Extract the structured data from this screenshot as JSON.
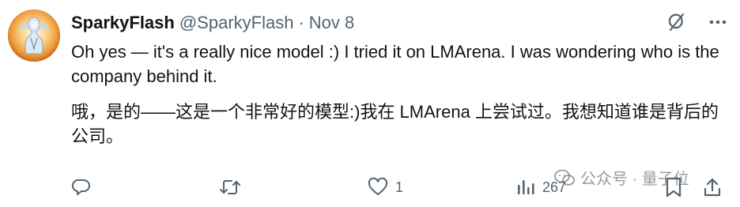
{
  "tweet": {
    "display_name": "SparkyFlash",
    "handle": "@SparkyFlash",
    "separator": "·",
    "date": "Nov 8",
    "text_en": "Oh yes — it's a really nice model :) I tried it on LMArena. I was wondering who is the company behind it.",
    "text_zh": "哦，是的——这是一个非常好的模型:)我在 LMArena 上尝试过。我想知道谁是背后的公司。"
  },
  "header_icons": [
    "grok-icon",
    "more-icon"
  ],
  "actions": {
    "reply": {
      "icon": "reply-icon",
      "count": ""
    },
    "retweet": {
      "icon": "retweet-icon",
      "count": ""
    },
    "like": {
      "icon": "heart-icon",
      "count": "1"
    },
    "views": {
      "icon": "views-icon",
      "count": "267"
    },
    "bookmark": {
      "icon": "bookmark-icon"
    },
    "share": {
      "icon": "share-icon"
    }
  },
  "watermark": {
    "text": "公众号 · 量子位"
  },
  "colors": {
    "text_primary": "#0f1419",
    "text_secondary": "#536471",
    "background": "#ffffff"
  }
}
